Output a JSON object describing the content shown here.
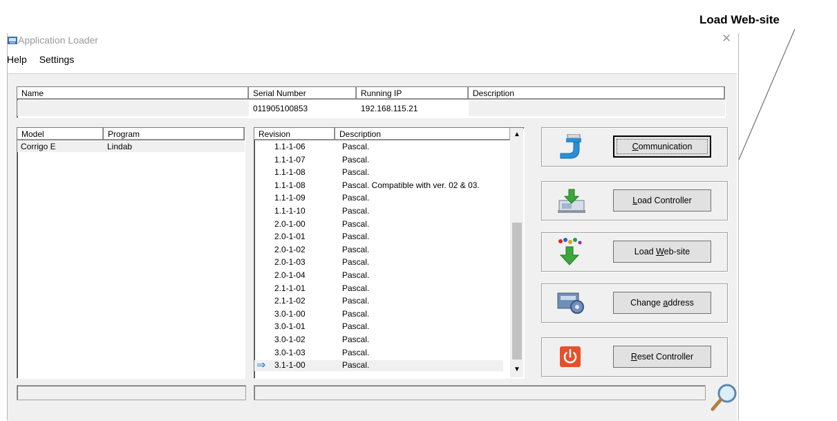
{
  "annotation": {
    "label": "Load Web-site"
  },
  "window": {
    "title": "Application Loader",
    "close_glyph": "✕"
  },
  "menu": {
    "items": [
      "Help",
      "Settings"
    ]
  },
  "device_table": {
    "columns": [
      "Name",
      "Serial Number",
      "Running IP",
      "Description"
    ],
    "row": {
      "name": "",
      "serial": "011905100853",
      "ip": "192.168.115.21",
      "description": ""
    }
  },
  "model_table": {
    "columns": [
      "Model",
      "Program"
    ],
    "rows": [
      {
        "model": "Corrigo E",
        "program": "Lindab"
      }
    ]
  },
  "revision_table": {
    "columns": [
      "Revision",
      "Description"
    ],
    "rows": [
      {
        "revision": "1.1-1-06",
        "description": "Pascal."
      },
      {
        "revision": "1.1-1-07",
        "description": "Pascal."
      },
      {
        "revision": "1.1-1-08",
        "description": "Pascal."
      },
      {
        "revision": "1.1-1-08",
        "description": "Pascal. Compatible with ver. 02 & 03."
      },
      {
        "revision": "1.1-1-09",
        "description": "Pascal."
      },
      {
        "revision": "1.1-1-10",
        "description": "Pascal."
      },
      {
        "revision": "2.0-1-00",
        "description": "Pascal."
      },
      {
        "revision": "2.0-1-01",
        "description": "Pascal."
      },
      {
        "revision": "2.0-1-02",
        "description": "Pascal."
      },
      {
        "revision": "2.0-1-03",
        "description": "Pascal."
      },
      {
        "revision": "2.0-1-04",
        "description": "Pascal."
      },
      {
        "revision": "2.1-1-01",
        "description": "Pascal."
      },
      {
        "revision": "2.1-1-02",
        "description": "Pascal."
      },
      {
        "revision": "3.0-1-00",
        "description": "Pascal."
      },
      {
        "revision": "3.0-1-01",
        "description": "Pascal."
      },
      {
        "revision": "3.0-1-02",
        "description": "Pascal."
      },
      {
        "revision": "3.0-1-03",
        "description": "Pascal."
      },
      {
        "revision": "3.1-1-00",
        "description": "Pascal.",
        "current": true
      }
    ]
  },
  "actions": [
    {
      "id": "communication",
      "label": "Communication",
      "mnemonic": "C",
      "icon": "connector-plug-icon"
    },
    {
      "id": "load-controller",
      "label": "Load Controller",
      "mnemonic": "L",
      "icon": "load-controller-icon"
    },
    {
      "id": "load-website",
      "label": "Load Web-site",
      "mnemonic": "W",
      "icon": "download-arrow-icon"
    },
    {
      "id": "change-address",
      "label": "Change address",
      "mnemonic": "a",
      "icon": "address-card-gear-icon"
    },
    {
      "id": "reset-controller",
      "label": "Reset Controller",
      "mnemonic": "R",
      "icon": "power-icon"
    }
  ],
  "colors": {
    "accent_arrow": "#1e7fd8",
    "reset_red": "#e8502a",
    "download_green": "#3aa83a",
    "plug_blue": "#2a8fd8"
  }
}
